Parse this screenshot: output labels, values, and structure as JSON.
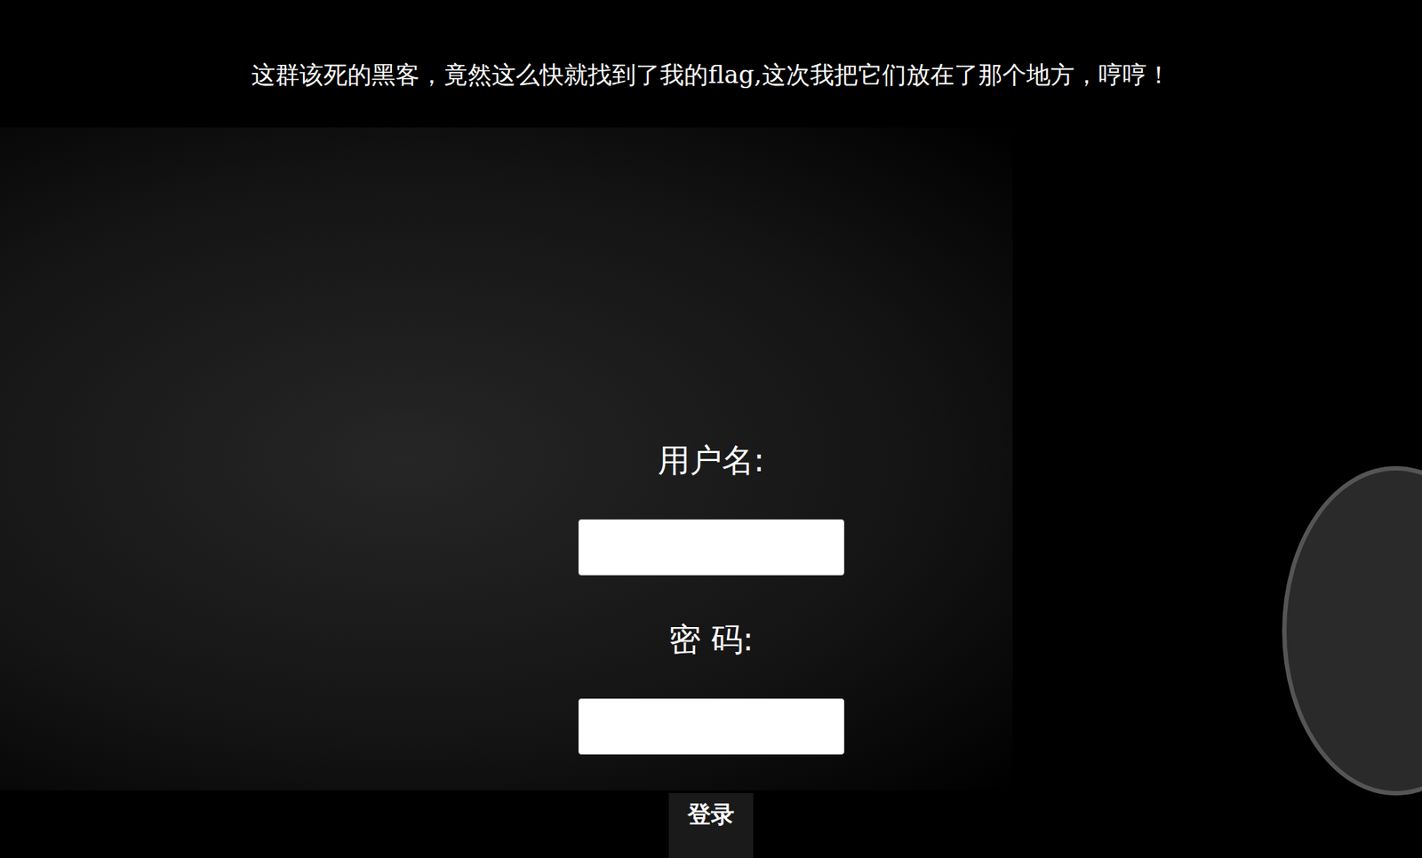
{
  "page": {
    "title": "这群该死的黑客，竟然这么快就找到了我的flag,这次我把它们放在了那个地方，哼哼！"
  },
  "form": {
    "fields": [
      {
        "label": "用户名:",
        "type": "text",
        "value": ""
      },
      {
        "label": "密 码:",
        "type": "password",
        "value": ""
      }
    ],
    "button": "登录"
  }
}
